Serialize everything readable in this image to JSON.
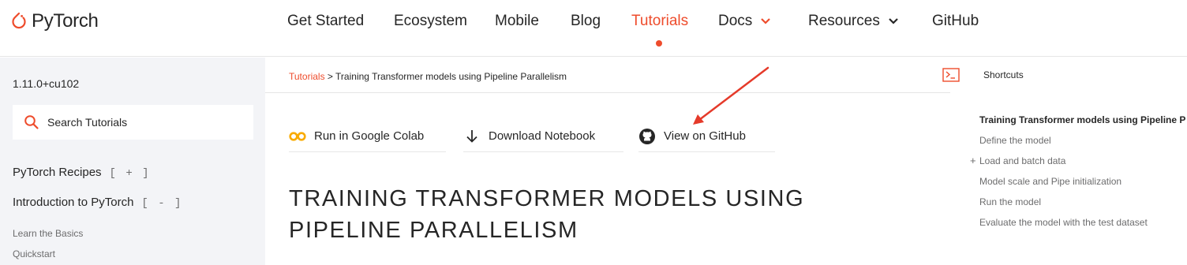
{
  "header": {
    "logo_text": "PyTorch",
    "nav": [
      {
        "label": "Get Started"
      },
      {
        "label": "Ecosystem"
      },
      {
        "label": "Mobile"
      },
      {
        "label": "Blog"
      },
      {
        "label": "Tutorials"
      },
      {
        "label": "Docs"
      },
      {
        "label": "Resources"
      },
      {
        "label": "GitHub"
      }
    ],
    "active_nav": "Tutorials"
  },
  "sidebar": {
    "version": "1.11.0+cu102",
    "search_placeholder": "Search Tutorials",
    "sections": [
      {
        "label": "PyTorch Recipes",
        "toggle": "[ + ]"
      },
      {
        "label": "Introduction to PyTorch",
        "toggle": "[ - ]"
      }
    ],
    "links": [
      "Learn the Basics",
      "Quickstart"
    ]
  },
  "breadcrumb": {
    "root": "Tutorials",
    "separator": " > ",
    "current": "Training Transformer models using Pipeline Parallelism"
  },
  "actions": [
    {
      "label": "Run in Google Colab",
      "icon": "colab-icon"
    },
    {
      "label": "Download Notebook",
      "icon": "download-arrow-icon"
    },
    {
      "label": "View on GitHub",
      "icon": "github-icon"
    }
  ],
  "page_title": "TRAINING TRANSFORMER MODELS USING PIPELINE PARALLELISM",
  "shortcuts": {
    "label": "Shortcuts",
    "toc": [
      {
        "label": "Training Transformer models using Pipeline P",
        "current": true
      },
      {
        "label": "Define the model"
      },
      {
        "label": "Load and batch data",
        "expand": "+"
      },
      {
        "label": "Model scale and Pipe initialization"
      },
      {
        "label": "Run the model"
      },
      {
        "label": "Evaluate the model with the test dataset"
      }
    ]
  },
  "colors": {
    "accent": "#ee4c2c",
    "text": "#262626",
    "muted": "#6c6c6d",
    "sidebar_bg": "#f3f4f7",
    "annotation_arrow": "#e53a2a"
  }
}
